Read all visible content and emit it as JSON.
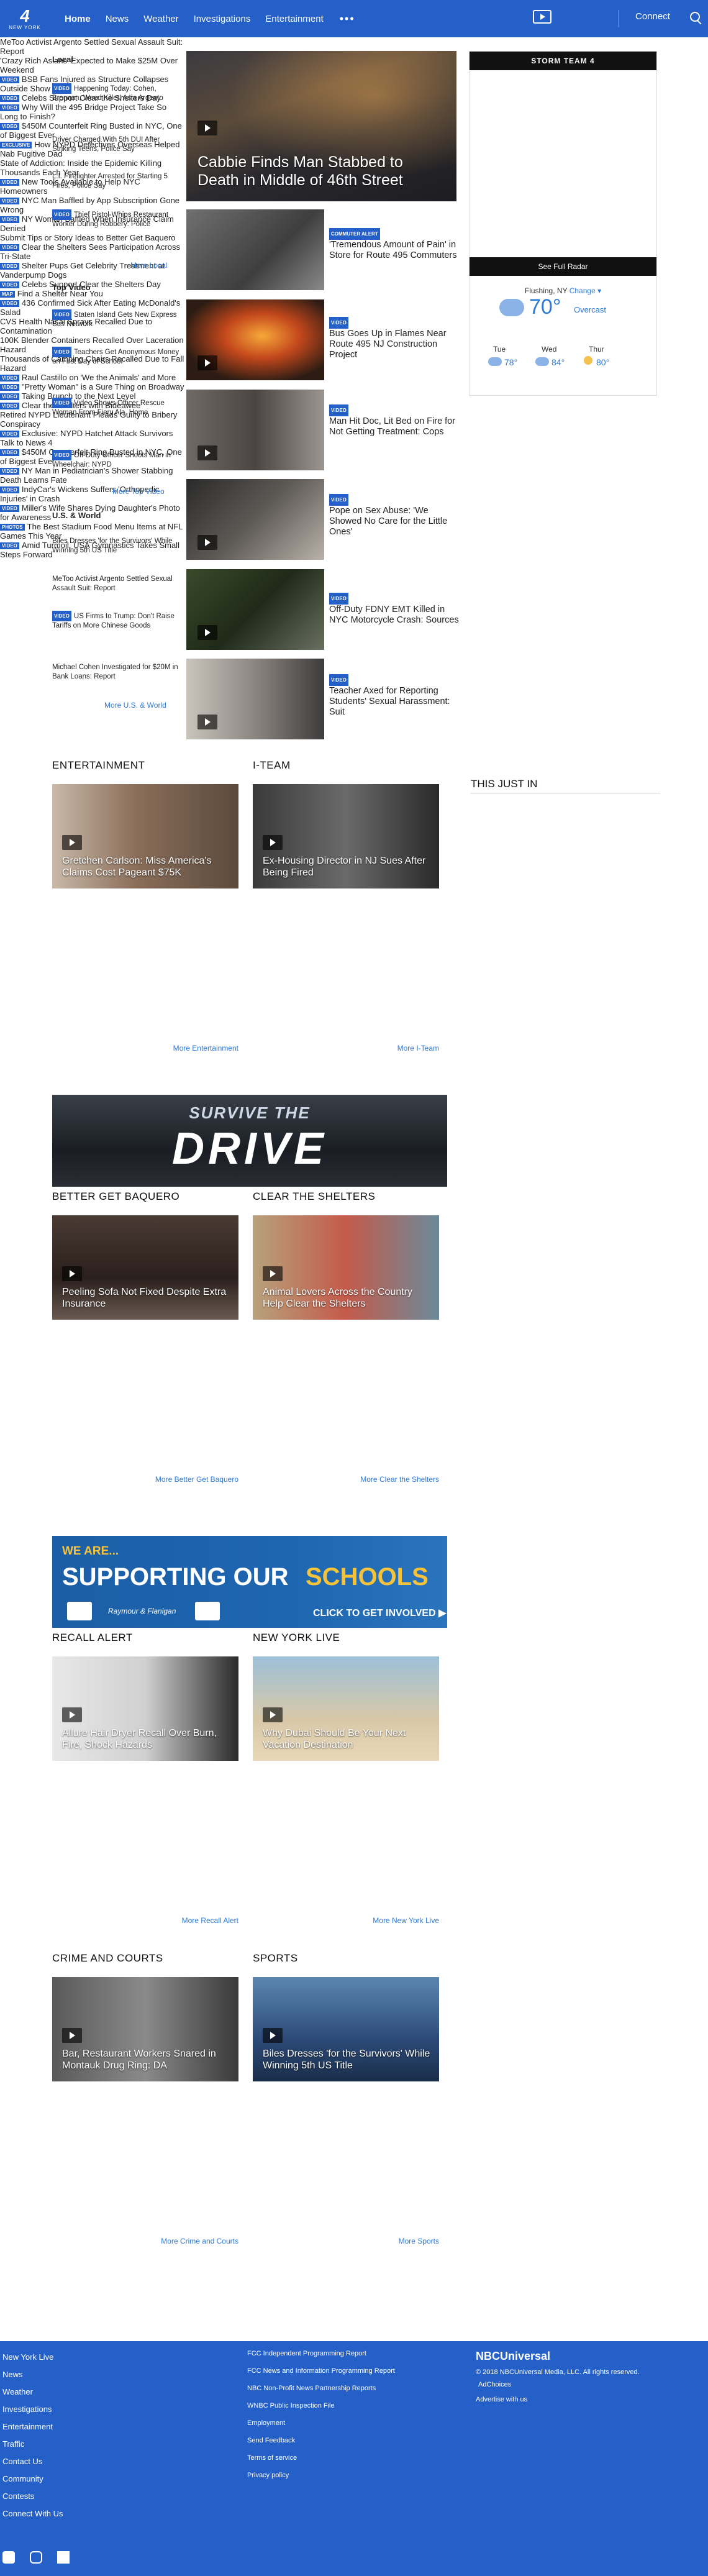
{
  "header": {
    "logo": "4",
    "city": "NEW YORK",
    "nav": [
      "Home",
      "News",
      "Weather",
      "Investigations",
      "Entertainment"
    ],
    "more": "•••",
    "connect": "Connect"
  },
  "local": {
    "title": "Local",
    "items": [
      {
        "badge": "VIDEO",
        "text": "Happening Today: Cohen, Brennan, Weed Killer, Asia Argento"
      },
      {
        "badge": "",
        "text": "Driver Charged With 5th DUI After Striking Teens, Police Say"
      },
      {
        "badge": "",
        "text": "L.I. Firefighter Arrested for Starting 5 Fires, Police Say"
      },
      {
        "badge": "VIDEO",
        "text": "Thief Pistol-Whips Restaurant Worker During Robbery: Police"
      }
    ],
    "more": "More Local"
  },
  "topvideo": {
    "title": "Top Video",
    "items": [
      {
        "badge": "VIDEO",
        "text": "Staten Island Gets New Express Bus Network"
      },
      {
        "badge": "VIDEO",
        "text": "Teachers Get Anonymous Money on First Day of School"
      },
      {
        "badge": "VIDEO",
        "text": "Video Shows Officer Rescue Woman From Fiery Ala. Home"
      },
      {
        "badge": "VIDEO",
        "text": "Off-Duty Officer Shoots Man in Wheelchair: NYPD"
      }
    ],
    "more": "More Top Video"
  },
  "usworld": {
    "title": "U.S. & World",
    "items": [
      {
        "badge": "",
        "text": "Biles Dresses 'for the Survivors' While Winning 5th US Title"
      },
      {
        "badge": "",
        "text": "MeToo Activist Argento Settled Sexual Assault Suit: Report"
      },
      {
        "badge": "VIDEO",
        "text": "US Firms to Trump: Don't Raise Tariffs on More Chinese Goods"
      },
      {
        "badge": "",
        "text": "Michael Cohen Investigated for $20M in Bank Loans: Report"
      }
    ],
    "more": "More U.S. & World"
  },
  "lead": {
    "headline": "Cabbie Finds Man Stabbed to Death in Middle of 46th Street"
  },
  "stories": [
    {
      "badge": "COMMUTER ALERT",
      "text": "'Tremendous Amount of Pain' in Store for Route 495 Commuters"
    },
    {
      "badge": "VIDEO",
      "text": "Bus Goes Up in Flames Near Route 495 NJ Construction Project"
    },
    {
      "badge": "VIDEO",
      "text": "Man Hit Doc, Lit Bed on Fire for Not Getting Treatment: Cops"
    },
    {
      "badge": "VIDEO",
      "text": "Pope on Sex Abuse: 'We Showed No Care for the Little Ones'"
    },
    {
      "badge": "VIDEO",
      "text": "Off-Duty FDNY EMT Killed in NYC Motorcycle Crash: Sources"
    },
    {
      "badge": "VIDEO",
      "text": "Teacher Axed for Reporting Students' Sexual Harassment: Suit"
    }
  ],
  "weather": {
    "banner": "STORM TEAM 4",
    "radar": "See Full Radar",
    "location": "Flushing, NY",
    "change": "Change",
    "temp": "70°",
    "cond": "Overcast",
    "days": [
      {
        "d": "Tue",
        "t": "78°"
      },
      {
        "d": "Wed",
        "t": "84°"
      },
      {
        "d": "Thur",
        "t": "80°"
      }
    ]
  },
  "thisjustin": "THIS JUST IN",
  "blocks": [
    {
      "title": "ENTERTAINMENT",
      "card": "Gretchen Carlson: Miss America's Claims Cost Pageant $75K",
      "items": [
        {
          "badge": "",
          "text": "MeToo Activist Argento Settled Sexual Assault Suit: Report"
        },
        {
          "badge": "",
          "text": "'Crazy Rich Asians' Expected to Make $25M Over Weekend"
        },
        {
          "badge": "VIDEO",
          "text": "BSB Fans Injured as Structure Collapses Outside Show"
        },
        {
          "badge": "VIDEO",
          "text": "Celebs Support Clear the Shelters Day"
        }
      ],
      "more": "More Entertainment"
    },
    {
      "title": "I-TEAM",
      "card": "Ex-Housing Director in NJ Sues After Being Fired",
      "items": [
        {
          "badge": "VIDEO",
          "text": "Why Will the 495 Bridge Project Take So Long to Finish?"
        },
        {
          "badge": "VIDEO",
          "text": "$450M Counterfeit Ring Busted in NYC, One of Biggest Ever"
        },
        {
          "badge": "EXCLUSIVE",
          "text": "How NYPD Detectives Overseas Helped Nab Fugitive Dad"
        },
        {
          "badge": "",
          "text": "State of Addiction: Inside the Epidemic Killing Thousands Each Year"
        }
      ],
      "more": "More I-Team"
    },
    {
      "title": "BETTER GET BAQUERO",
      "card": "Peeling Sofa Not Fixed Despite Extra Insurance",
      "items": [
        {
          "badge": "VIDEO",
          "text": "New Tools Available to Help NYC Homeowners"
        },
        {
          "badge": "VIDEO",
          "text": "NYC Man Baffled by App Subscription Gone Wrong"
        },
        {
          "badge": "VIDEO",
          "text": "NY Woman Baffled When Insurance Claim Denied"
        },
        {
          "badge": "",
          "text": "Submit Tips or Story Ideas to Better Get Baquero"
        }
      ],
      "more": "More Better Get Baquero"
    },
    {
      "title": "CLEAR THE SHELTERS",
      "card": "Animal Lovers Across the Country Help Clear the Shelters",
      "items": [
        {
          "badge": "VIDEO",
          "text": "Clear the Shelters Sees Participation Across Tri-State"
        },
        {
          "badge": "VIDEO",
          "text": "Shelter Pups Get Celebrity Treatment at Vanderpump Dogs"
        },
        {
          "badge": "VIDEO",
          "text": "Celebs Support Clear the Shelters Day"
        },
        {
          "badge": "MAP",
          "text": "Find a Shelter Near You"
        }
      ],
      "more": "More Clear the Shelters"
    },
    {
      "title": "RECALL ALERT",
      "card": "Allure Hair Dryer Recall Over Burn, Fire, Shock Hazards",
      "items": [
        {
          "badge": "VIDEO",
          "text": "436 Confirmed Sick After Eating McDonald's Salad"
        },
        {
          "badge": "",
          "text": "CVS Health Nasal Sprays Recalled Due to Contamination"
        },
        {
          "badge": "",
          "text": "100K Blender Containers Recalled Over Laceration Hazard"
        },
        {
          "badge": "",
          "text": "Thousands of Camping Chairs Recalled Due to Fall Hazard"
        }
      ],
      "more": "More Recall Alert"
    },
    {
      "title": "NEW YORK LIVE",
      "card": "Why Dubai Should Be Your Next Vacation Destination",
      "items": [
        {
          "badge": "VIDEO",
          "text": "Raul Castillo on 'We the Animals' and More"
        },
        {
          "badge": "VIDEO",
          "text": "\"Pretty Woman\" is a Sure Thing on Broadway"
        },
        {
          "badge": "VIDEO",
          "text": "Taking Brunch to the Next Level"
        },
        {
          "badge": "VIDEO",
          "text": "Clear the Shelters with Bideawee"
        }
      ],
      "more": "More New York Live"
    },
    {
      "title": "CRIME AND COURTS",
      "card": "Bar, Restaurant Workers Snared in Montauk Drug Ring: DA",
      "items": [
        {
          "badge": "",
          "text": "Retired NYPD Lieutenant Pleads Guilty to Bribery Conspiracy"
        },
        {
          "badge": "VIDEO",
          "text": "Exclusive: NYPD Hatchet Attack Survivors Talk to News 4"
        },
        {
          "badge": "VIDEO",
          "text": "$450M Counterfeit Ring Busted in NYC, One of Biggest Ever"
        },
        {
          "badge": "VIDEO",
          "text": "NY Man in Pediatrician's Shower Stabbing Death Learns Fate"
        }
      ],
      "more": "More Crime and Courts"
    },
    {
      "title": "SPORTS",
      "card": "Biles Dresses 'for the Survivors' While Winning 5th US Title",
      "items": [
        {
          "badge": "VIDEO",
          "text": "IndyCar's Wickens Suffers 'Orthopedic Injuries' in Crash"
        },
        {
          "badge": "VIDEO",
          "text": "Miller's Wife Shares Dying Daughter's Photo for Awareness"
        },
        {
          "badge": "PHOTOS",
          "text": "The Best Stadium Food Menu Items at NFL Games This Year"
        },
        {
          "badge": "VIDEO",
          "text": "Amid Turmoil, USA Gymnastics Takes Small Steps Forward"
        }
      ],
      "more": "More Sports"
    }
  ],
  "ads": {
    "drive_small": "SURVIVE THE",
    "drive_big": "DRIVE",
    "schools_1": "WE ARE...",
    "schools_2": "SUPPORTING OUR",
    "schools_3": "SCHOOLS",
    "schools_cta": "CLICK TO GET INVOLVED ▶",
    "schools_brand": "Raymour & Flanigan"
  },
  "footer": {
    "left": [
      "New York Live",
      "News",
      "Weather",
      "Investigations",
      "Entertainment",
      "Traffic",
      "Contact Us",
      "Community",
      "Contests",
      "Connect With Us"
    ],
    "mid": [
      "FCC Independent Programming Report",
      "FCC News and Information Programming Report",
      "NBC Non-Profit News Partnership Reports",
      "WNBC Public Inspection File",
      "Employment",
      "Send Feedback",
      "Terms of service",
      "Privacy policy"
    ],
    "brand": "NBCUniversal",
    "copy": "© 2018 NBCUniversal Media, LLC. All rights reserved.",
    "adchoices": "AdChoices",
    "advertise": "Advertise with us"
  }
}
